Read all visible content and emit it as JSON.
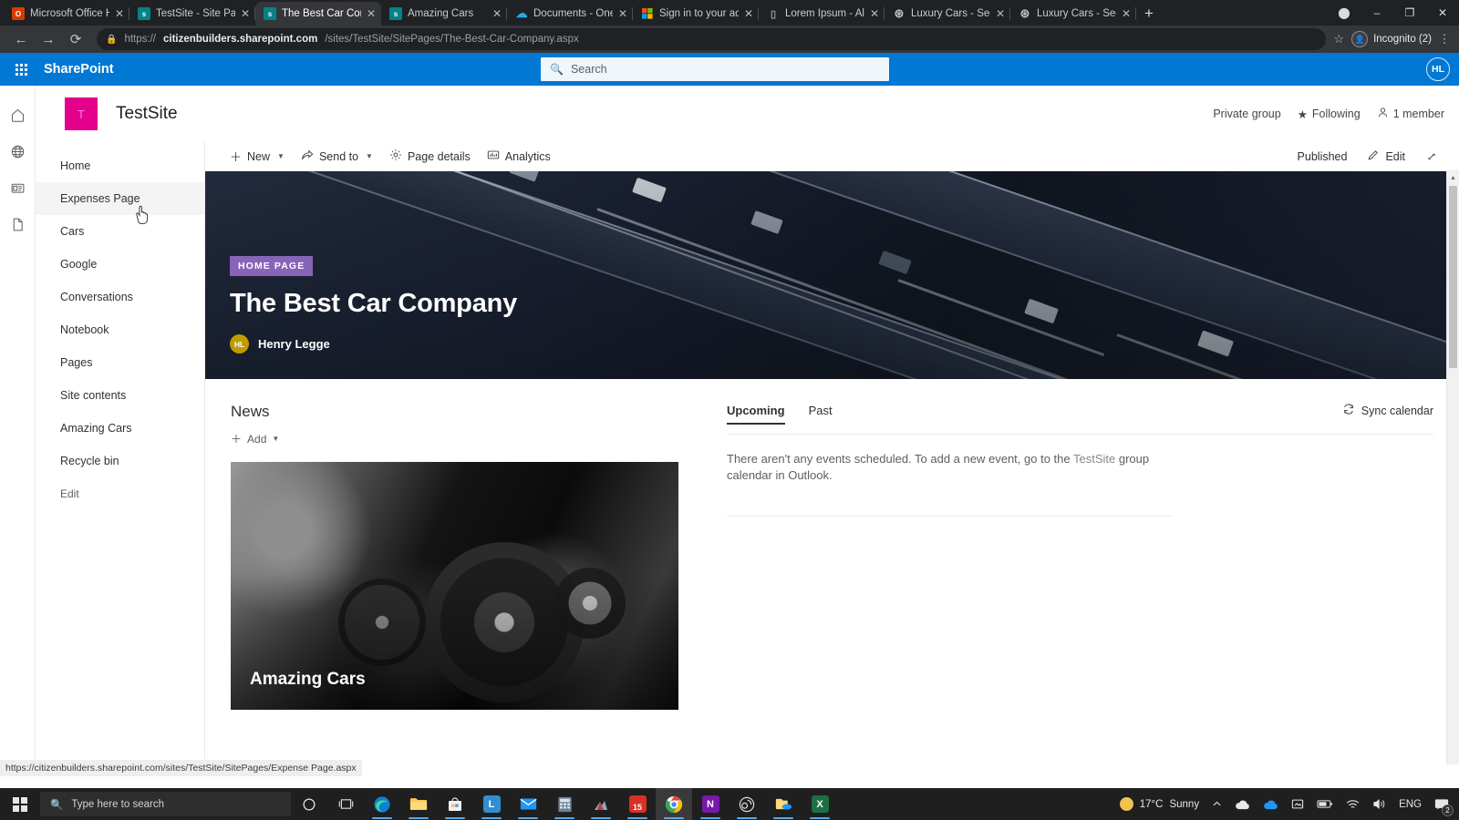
{
  "browser": {
    "tabs": [
      {
        "title": "Microsoft Office Home",
        "favicon": "office-icon",
        "active": false
      },
      {
        "title": "TestSite - Site Pages -",
        "favicon": "sharepoint-icon",
        "active": false
      },
      {
        "title": "The Best Car Company",
        "favicon": "sharepoint-icon",
        "active": true
      },
      {
        "title": "Amazing Cars",
        "favicon": "sharepoint-icon",
        "active": false
      },
      {
        "title": "Documents - OneDriv",
        "favicon": "onedrive-icon",
        "active": false
      },
      {
        "title": "Sign in to your accoun",
        "favicon": "microsoft-icon",
        "active": false
      },
      {
        "title": "Lorem Ipsum - All the",
        "favicon": "generic-page-icon",
        "active": false
      },
      {
        "title": "Luxury Cars - Sedans,",
        "favicon": "mercedes-icon",
        "active": false
      },
      {
        "title": "Luxury Cars - Sedans,",
        "favicon": "mercedes-icon",
        "active": false
      }
    ],
    "new_tab_label": "+",
    "close_glyph": "✕",
    "window_controls": {
      "minimize": "–",
      "maximize": "❐",
      "close": "✕"
    },
    "url": {
      "protocol": "https://",
      "domain": "citizenbuilders.sharepoint.com",
      "path": "/sites/TestSite/SitePages/The-Best-Car-Company.aspx"
    },
    "profile_label": "Incognito (2)",
    "back_glyph": "←",
    "forward_glyph": "→",
    "reload_glyph": "⟳",
    "lock_icon": "lock-icon",
    "star_icon": "bookmark-star-icon",
    "menu_icon": "kebab-menu-icon"
  },
  "suite": {
    "brand": "SharePoint",
    "waffle_icon": "app-launcher-icon",
    "search_placeholder": "Search",
    "search_value": "",
    "search_icon": "search-icon",
    "avatar_initials": "HL",
    "accent": "#0078d4"
  },
  "left_rail": [
    {
      "name": "home-icon"
    },
    {
      "name": "globe-icon"
    },
    {
      "name": "news-feed-icon"
    },
    {
      "name": "document-icon"
    }
  ],
  "site": {
    "logo_letter": "T",
    "logo_color": "#e3008c",
    "title": "TestSite",
    "privacy": "Private group",
    "following": "Following",
    "following_icon": "star-icon",
    "members": "1 member",
    "members_icon": "person-icon"
  },
  "nav": {
    "items": [
      {
        "label": "Home",
        "hovered": false,
        "muted": false
      },
      {
        "label": "Expenses Page",
        "hovered": true,
        "muted": false
      },
      {
        "label": "Cars",
        "hovered": false,
        "muted": false
      },
      {
        "label": "Google",
        "hovered": false,
        "muted": false
      },
      {
        "label": "Conversations",
        "hovered": false,
        "muted": false
      },
      {
        "label": "Notebook",
        "hovered": false,
        "muted": false
      },
      {
        "label": "Pages",
        "hovered": false,
        "muted": false
      },
      {
        "label": "Site contents",
        "hovered": false,
        "muted": false
      },
      {
        "label": "Amazing Cars",
        "hovered": false,
        "muted": false
      },
      {
        "label": "Recycle bin",
        "hovered": false,
        "muted": false
      },
      {
        "label": "Edit",
        "hovered": false,
        "muted": true
      }
    ]
  },
  "command_bar": {
    "new_label": "New",
    "new_icon": "plus-icon",
    "send_to_label": "Send to",
    "send_to_icon": "share-icon",
    "page_details_label": "Page details",
    "page_details_icon": "gear-icon",
    "analytics_label": "Analytics",
    "analytics_icon": "analytics-icon",
    "status_label": "Published",
    "edit_label": "Edit",
    "edit_icon": "pencil-icon",
    "expand_icon": "full-screen-icon",
    "chevron_icon": "chevron-down-icon"
  },
  "hero": {
    "badge": "HOME PAGE",
    "badge_color": "#8764b8",
    "title": "The Best Car Company",
    "author_initials": "HL",
    "author_name": "Henry Legge",
    "author_avatar_color": "#c19c00",
    "image_alt": "aerial-highway-photo"
  },
  "news": {
    "title": "News",
    "add_label": "Add",
    "add_icon": "plus-icon",
    "chevron_icon": "chevron-down-icon",
    "cards": [
      {
        "title": "Amazing Cars",
        "image_alt": "vintage-car-black-and-white-photo"
      }
    ]
  },
  "events": {
    "tabs": [
      {
        "label": "Upcoming",
        "active": true
      },
      {
        "label": "Past",
        "active": false
      }
    ],
    "sync_label": "Sync calendar",
    "sync_icon": "refresh-icon",
    "empty_text_before": "There aren't any events scheduled. To add a new event, go to the ",
    "empty_link": "TestSite",
    "empty_text_after": " group calendar in Outlook."
  },
  "status_bar": {
    "url": "https://citizenbuilders.sharepoint.com/sites/TestSite/SitePages/Expense Page.aspx"
  },
  "taskbar": {
    "start_icon": "windows-start-icon",
    "search_placeholder": "Type here to search",
    "search_icon": "search-icon",
    "items": [
      {
        "name": "cortana-icon",
        "glyph": "○"
      },
      {
        "name": "task-view-icon",
        "glyph": "❏"
      },
      {
        "name": "edge-icon",
        "glyph": ""
      },
      {
        "name": "file-explorer-icon",
        "glyph": ""
      },
      {
        "name": "microsoft-store-icon",
        "glyph": ""
      },
      {
        "name": "linkedin-icon",
        "glyph": "L"
      },
      {
        "name": "mail-icon",
        "glyph": ""
      },
      {
        "name": "calculator-icon",
        "glyph": ""
      },
      {
        "name": "windows-media-icon",
        "glyph": ""
      },
      {
        "name": "calendar-icon",
        "glyph": "15"
      },
      {
        "name": "chrome-icon",
        "glyph": ""
      },
      {
        "name": "onenote-icon",
        "glyph": "N"
      },
      {
        "name": "obs-icon",
        "glyph": ""
      },
      {
        "name": "onedrive-folder-icon",
        "glyph": ""
      },
      {
        "name": "excel-icon",
        "glyph": "X"
      }
    ],
    "tray": {
      "weather_temp": "17°C",
      "weather_desc": "Sunny",
      "weather_icon": "sun-icon",
      "chevron_icon": "chevron-up-icon",
      "onedrive_personal_icon": "cloud-white-icon",
      "onedrive_work_icon": "cloud-blue-icon",
      "screenshot_icon": "snip-icon",
      "battery_icon": "battery-icon",
      "wifi_icon": "wifi-icon",
      "volume_icon": "speaker-icon",
      "language": "ENG",
      "notifications_icon": "notification-icon",
      "notification_count": "2"
    }
  }
}
